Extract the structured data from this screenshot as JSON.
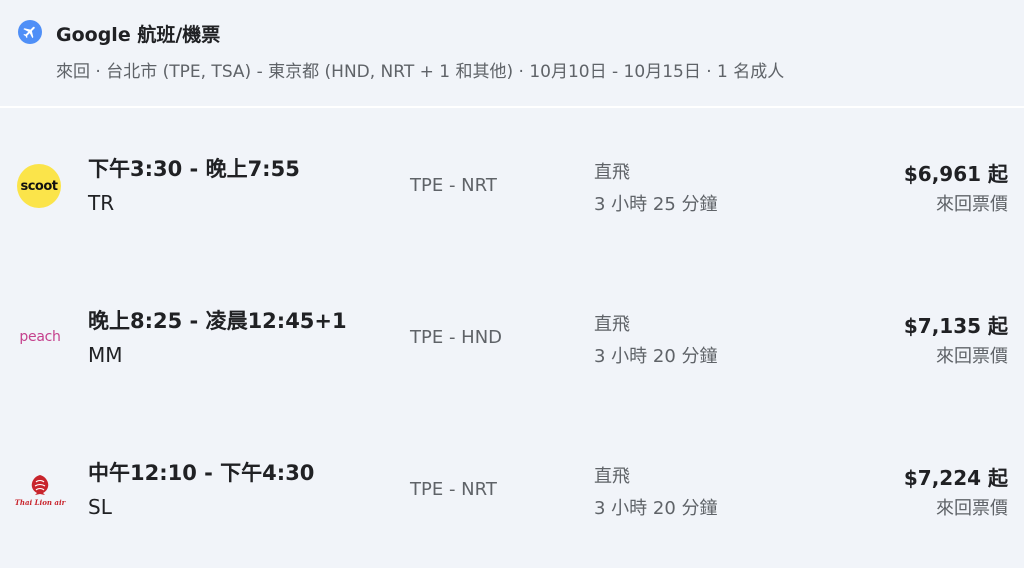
{
  "header": {
    "title": "Google 航班/機票",
    "subtitle": "來回 · 台北市 (TPE, TSA) - 東京都 (HND, NRT + 1 和其他) · 10月10日 - 10月15日 · 1 名成人",
    "icon": "airplane-icon",
    "icon_color": "#4f8ff7"
  },
  "flights": [
    {
      "logo_text": "scoot",
      "logo_icon": "scoot-logo",
      "times": "下午3:30 - 晚上7:55",
      "airline": "TR",
      "route": "TPE - NRT",
      "stops": "直飛",
      "duration": "3 小時 25 分鐘",
      "price": "$6,961 起",
      "price_note": "來回票價"
    },
    {
      "logo_text": "peach",
      "logo_icon": "peach-logo",
      "times": "晚上8:25 - 凌晨12:45+1",
      "airline": "MM",
      "route": "TPE - HND",
      "stops": "直飛",
      "duration": "3 小時 20 分鐘",
      "price": "$7,135 起",
      "price_note": "來回票價"
    },
    {
      "logo_text": "Thai Lion air",
      "logo_icon": "thai-lion-air-logo",
      "times": "中午12:10 - 下午4:30",
      "airline": "SL",
      "route": "TPE - NRT",
      "stops": "直飛",
      "duration": "3 小時 20 分鐘",
      "price": "$7,224 起",
      "price_note": "來回票價"
    }
  ],
  "colors": {
    "background": "#f1f4f9",
    "primary_text": "#202124",
    "secondary_text": "#5f6368",
    "scoot_yellow": "#fbe44a",
    "peach_magenta": "#c5418d",
    "thai_lion_red": "#c8242c"
  }
}
